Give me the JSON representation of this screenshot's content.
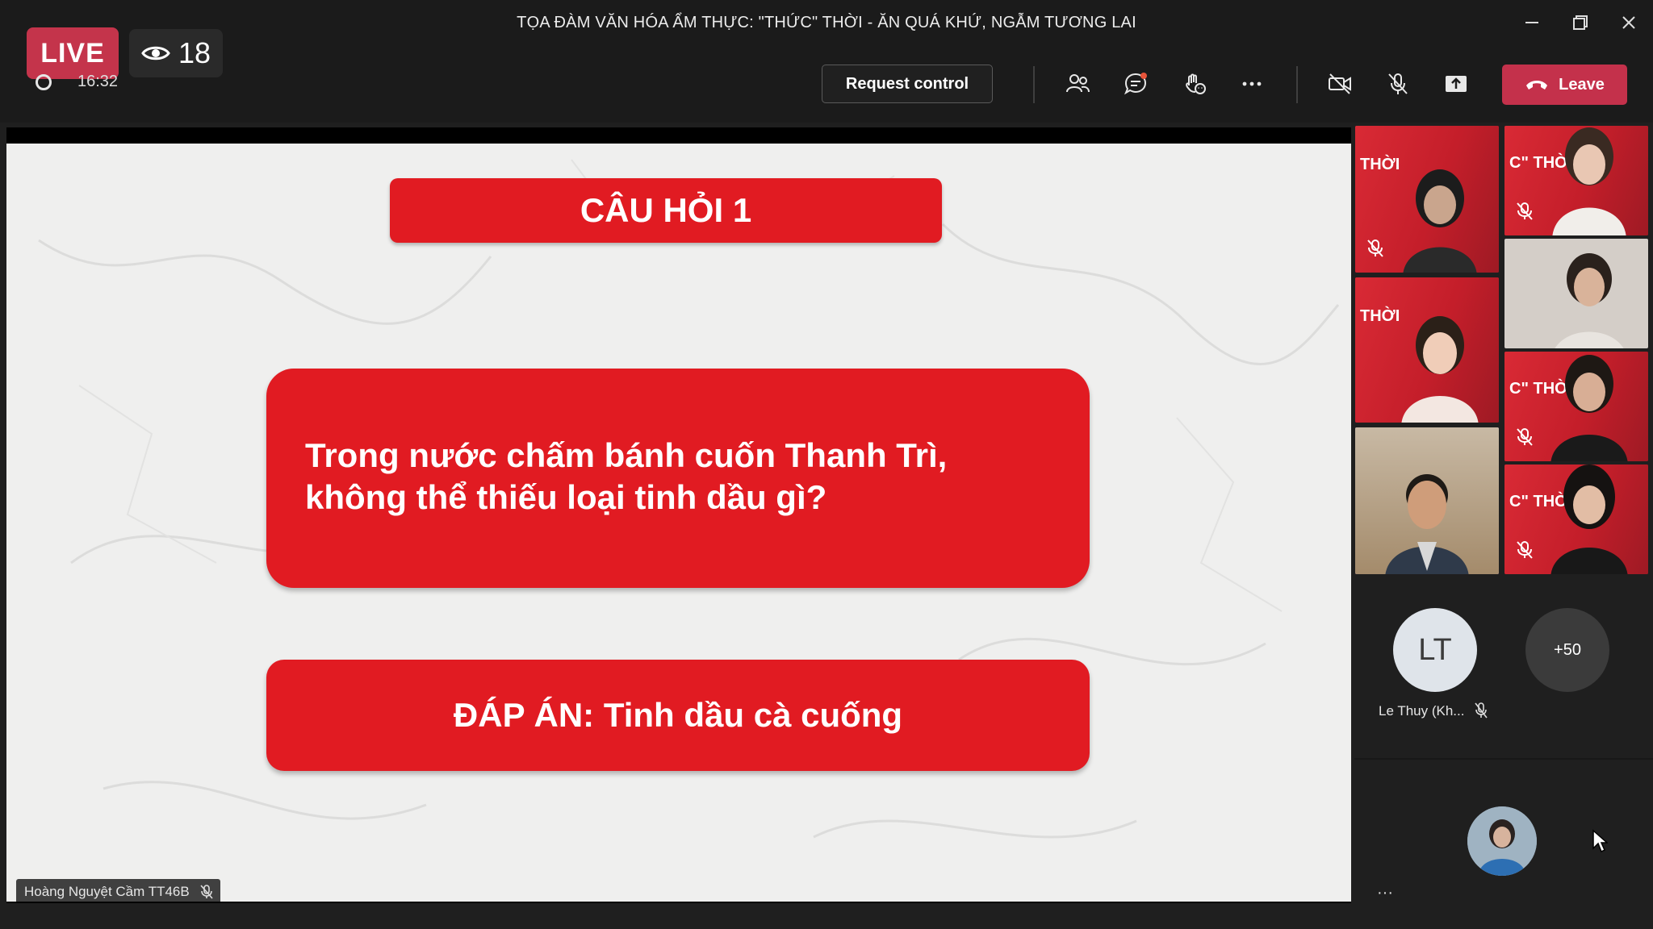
{
  "window": {
    "title": "TỌA ĐÀM VĂN HÓA ẨM THỰC: \"THỨC\" THỜI - ĂN QUÁ KHỨ, NGẪM TƯƠNG LAI"
  },
  "overlay": {
    "live_label": "LIVE",
    "viewer_count": "18"
  },
  "toolbar": {
    "timer": "16:32",
    "request_control_label": "Request control",
    "leave_label": "Leave",
    "icons": [
      "people-icon",
      "chat-icon",
      "reactions-icon",
      "more-icon",
      "camera-off-icon",
      "mic-off-icon",
      "share-icon"
    ]
  },
  "slide": {
    "question_title": "CÂU HỎI 1",
    "question_line1": "Trong nước chấm bánh cuốn Thanh Trì,",
    "question_line2": "không thể thiếu loại tinh dầu gì?",
    "answer": "ĐÁP ÁN: Tinh dầu cà cuống",
    "presenter_name": "Hoàng Nguyệt Cầm TT46B"
  },
  "participants": {
    "tile_banner_text": "THỜI",
    "tile_banner_text_2": "C\" THỜI",
    "lt_initials": "LT",
    "lt_name": "Le Thuy (Kh...",
    "overflow_count": "+50",
    "more_label": "···"
  },
  "colors": {
    "slide_red": "#e11b22",
    "live_red": "#c4344b",
    "leave_red": "#c4314b",
    "active_speaker_outline": "#7b83eb"
  }
}
